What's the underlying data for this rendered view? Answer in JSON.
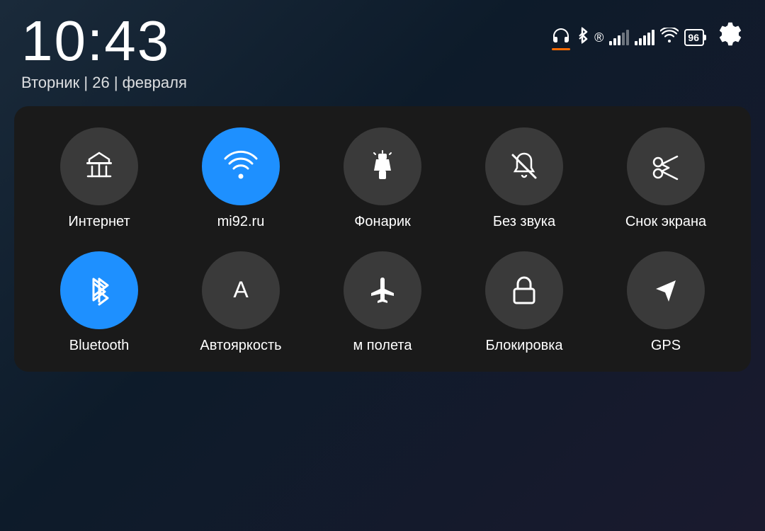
{
  "statusBar": {
    "time": "10:43",
    "date": "Вторник | 26 | февраля",
    "battery": "96",
    "settingsIcon": "⚙"
  },
  "quickSettings": {
    "rows": [
      [
        {
          "id": "internet",
          "label": "Интернет",
          "active": false,
          "icon": "mobile-data"
        },
        {
          "id": "wifi",
          "label": "mi92.ru",
          "active": true,
          "icon": "wifi"
        },
        {
          "id": "flashlight",
          "label": "Фонарик",
          "active": false,
          "icon": "flashlight"
        },
        {
          "id": "silent",
          "label": "Без звука",
          "active": false,
          "icon": "silent"
        },
        {
          "id": "screenshot",
          "label": "Снок экрана",
          "active": false,
          "icon": "screenshot"
        }
      ],
      [
        {
          "id": "bluetooth",
          "label": "Bluetooth",
          "active": true,
          "icon": "bluetooth"
        },
        {
          "id": "brightness",
          "label": "Автояркость",
          "active": false,
          "icon": "brightness"
        },
        {
          "id": "airplane",
          "label": "м полета",
          "active": false,
          "icon": "airplane"
        },
        {
          "id": "lock",
          "label": "Блокировка",
          "active": false,
          "icon": "lock"
        },
        {
          "id": "gps",
          "label": "GPS",
          "active": false,
          "icon": "gps"
        }
      ]
    ]
  }
}
